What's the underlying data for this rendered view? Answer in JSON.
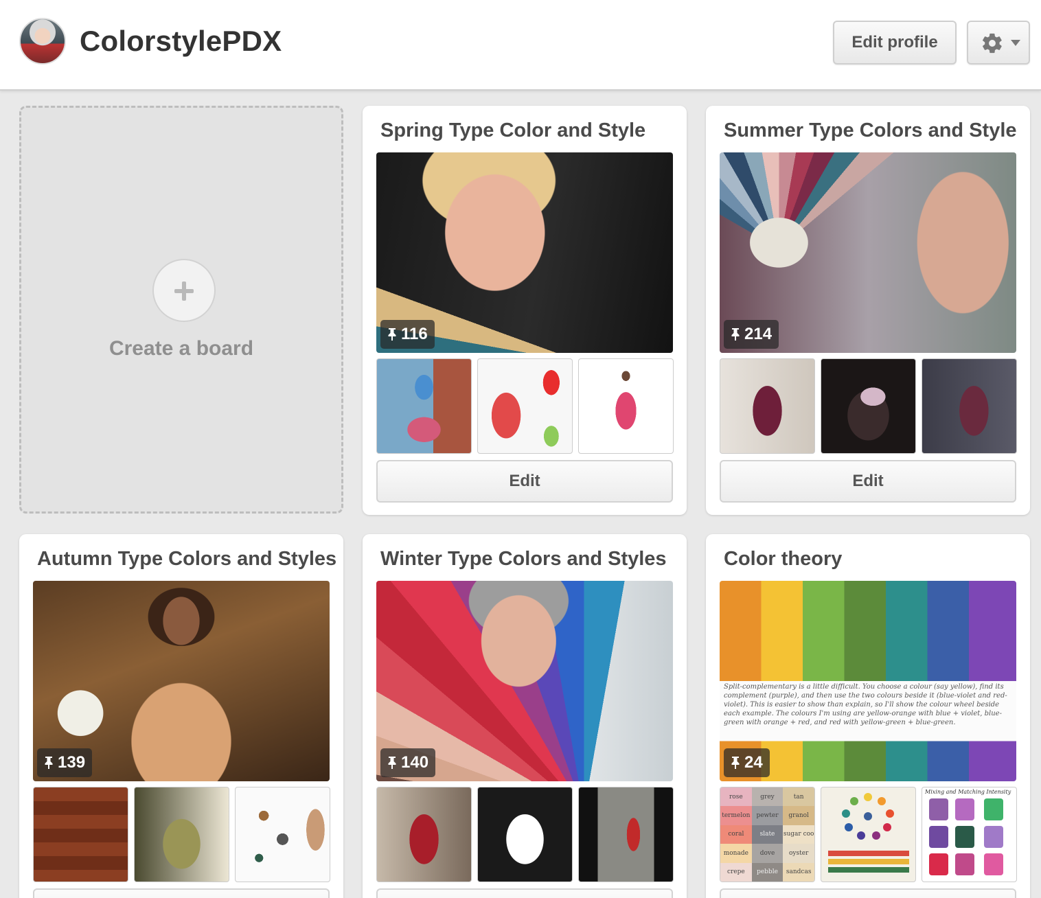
{
  "profile": {
    "username": "ColorstylePDX",
    "edit_profile_label": "Edit profile"
  },
  "create_board": {
    "label": "Create a board"
  },
  "boards": [
    {
      "title": "Spring Type Color and Style",
      "pin_count": "116",
      "edit_label": "Edit"
    },
    {
      "title": "Summer Type Colors and Style",
      "pin_count": "214",
      "edit_label": "Edit"
    },
    {
      "title": "Autumn Type Colors and Styles",
      "pin_count": "139"
    },
    {
      "title": "Winter Type Colors and Styles",
      "pin_count": "140"
    },
    {
      "title": "Color theory",
      "pin_count": "24",
      "cover_text": "Split-complementary is a little difficult. You choose a colour (say yellow), find its complement (purple), and then use the two colours beside it (blue-violet and red-violet). This is easier to show than explain, so I'll show the colour wheel beside each example. The colours I'm using are yellow-orange with blue + violet, blue-green with orange + red, and red with yellow-green + blue-green.",
      "thumb_swatches": [
        "rose",
        "grey",
        "tan",
        "termelon",
        "pewter",
        "granol",
        "coral",
        "slate",
        "sugar coo",
        "monade",
        "dove",
        "oyster",
        "crepe",
        "pebble",
        "sandcas"
      ],
      "thumb_cardigan_title": "Mixing and Matching Intensity"
    }
  ]
}
